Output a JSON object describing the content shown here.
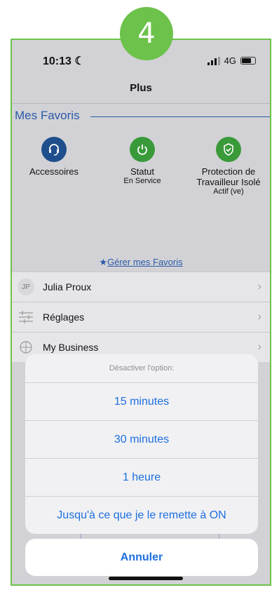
{
  "step_number": "4",
  "status_bar": {
    "time": "10:13",
    "network": "4G"
  },
  "nav": {
    "title": "Plus"
  },
  "favorites": {
    "header": "Mes Favoris",
    "items": [
      {
        "label": "Accessoires",
        "sub": "",
        "icon": "headset-icon",
        "color": "#1f4e8c"
      },
      {
        "label": "Statut",
        "sub": "En Service",
        "icon": "power-icon",
        "color": "#3a9a3a"
      },
      {
        "label": "Protection de Travailleur Isolé",
        "sub": "Actif (ve)",
        "icon": "shield-check-icon",
        "color": "#3a9a3a"
      }
    ],
    "manage_link": "Gérer mes Favoris"
  },
  "menu": [
    {
      "label": "Julia Proux",
      "icon": "avatar",
      "initials": "JP"
    },
    {
      "label": "Réglages",
      "icon": "sliders-icon"
    },
    {
      "label": "My Business",
      "icon": "grid-icon"
    }
  ],
  "action_sheet": {
    "title": "Désactiver l'option:",
    "options": [
      "15 minutes",
      "30 minutes",
      "1 heure",
      "Jusqu'à ce que je le remette à ON"
    ],
    "cancel": "Annuler"
  },
  "colors": {
    "accent": "#1d6fe0",
    "badge": "#6cc24a",
    "header": "#2a5aa8"
  }
}
